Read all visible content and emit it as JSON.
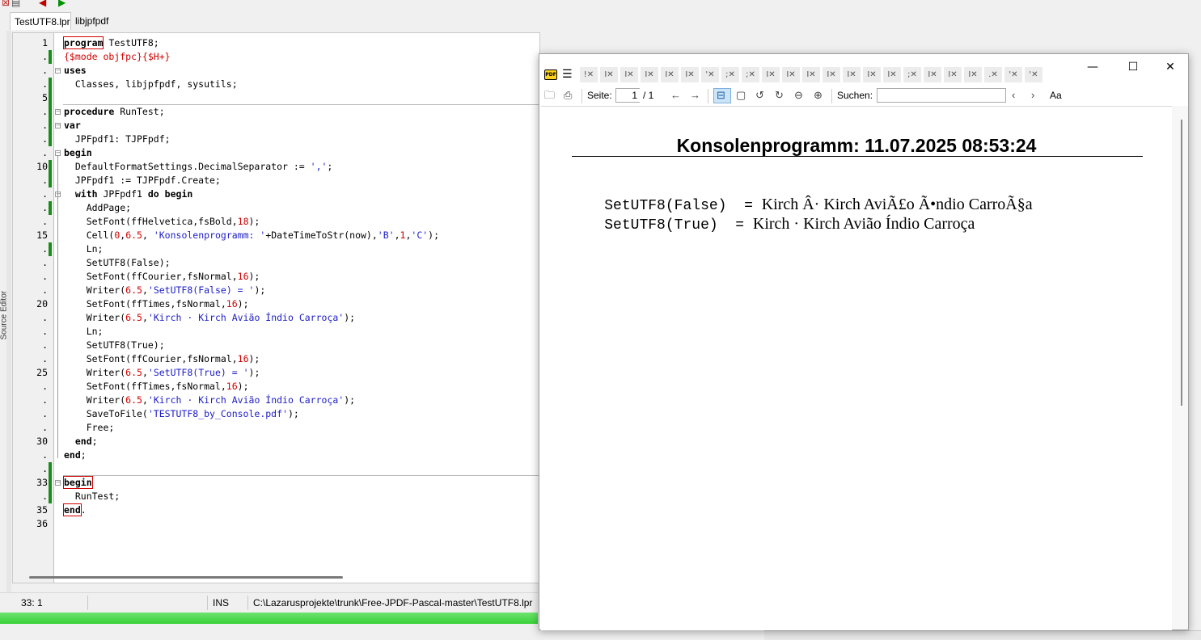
{
  "ide": {
    "tabs": [
      "TestUTF8.lpr",
      "libjpfpdf"
    ],
    "side_panel_label": "Source Editor",
    "line_numbers": [
      "1",
      ".",
      ".",
      ".",
      "5",
      ".",
      ".",
      ".",
      ".",
      "10",
      ".",
      ".",
      ".",
      ".",
      "15",
      ".",
      ".",
      ".",
      ".",
      "20",
      ".",
      ".",
      ".",
      ".",
      "25",
      ".",
      ".",
      ".",
      ".",
      "30",
      ".",
      ".",
      "33",
      ".",
      "35",
      "36"
    ],
    "code_lines": [
      "program TestUTF8;",
      "{$mode objfpc}{$H+}",
      "uses",
      "  Classes, libjpfpdf, sysutils;",
      "",
      "procedure RunTest;",
      "var",
      "  JPFpdf1: TJPFpdf;",
      "begin",
      "  DefaultFormatSettings.DecimalSeparator := ',';",
      "  JPFpdf1 := TJPFpdf.Create;",
      "  with JPFpdf1 do begin",
      "    AddPage;",
      "    SetFont(ffHelvetica,fsBold,18);",
      "    Cell(0,6.5, 'Konsolenprogramm: '+DateTimeToStr(now),'B',1,'C');",
      "    Ln;",
      "    SetUTF8(False);",
      "    SetFont(ffCourier,fsNormal,16);",
      "    Writer(6.5,'SetUTF8(False) = ');",
      "    SetFont(ffTimes,fsNormal,16);",
      "    Writer(6.5,'Kirch · Kirch Avião Índio Carroça');",
      "    Ln;",
      "    SetUTF8(True);",
      "    SetFont(ffCourier,fsNormal,16);",
      "    Writer(6.5,'SetUTF8(True) = ');",
      "    SetFont(ffTimes,fsNormal,16);",
      "    Writer(6.5,'Kirch · Kirch Avião Índio Carroça');",
      "    SaveToFile('TESTUTF8_by_Console.pdf');",
      "    Free;",
      "  end;",
      "end;",
      "",
      "begin",
      "  RunTest;",
      "end.",
      ""
    ],
    "status": {
      "cursor": "33: 1",
      "mode": "INS",
      "path": "C:\\Lazarusprojekte\\trunk\\Free-JPDF-Pascal-master\\TestUTF8.lpr"
    }
  },
  "viewer": {
    "window_controls": {
      "minimize": "—",
      "maximize": "☐",
      "close": "✕"
    },
    "tab_glyphs": [
      "!✕",
      "I✕",
      "I✕",
      "I✕",
      "I✕",
      "I✕",
      "'✕",
      ";✕",
      ";✕",
      "I✕",
      "I✕",
      "I✕",
      "I✕",
      "I✕",
      "I✕",
      "I✕",
      ";✕",
      "I✕",
      "I✕",
      "I✕",
      ".✕",
      "'✕",
      "'✕"
    ],
    "toolbar": {
      "page_label": "Seite:",
      "page_current": "1",
      "page_total": "/ 1",
      "search_label": "Suchen:",
      "match_case": "Aa"
    },
    "document": {
      "heading": "Konsolenprogramm: 11.07.2025 08:53:24",
      "line1_mono": "SetUTF8(False)  = ",
      "line1_serif": "Kirch Â· Kirch AviÃ£o Ã•ndio CarroÃ§a",
      "line2_mono": "SetUTF8(True)  = ",
      "line2_serif": "Kirch · Kirch Avião Índio Carroça"
    }
  }
}
